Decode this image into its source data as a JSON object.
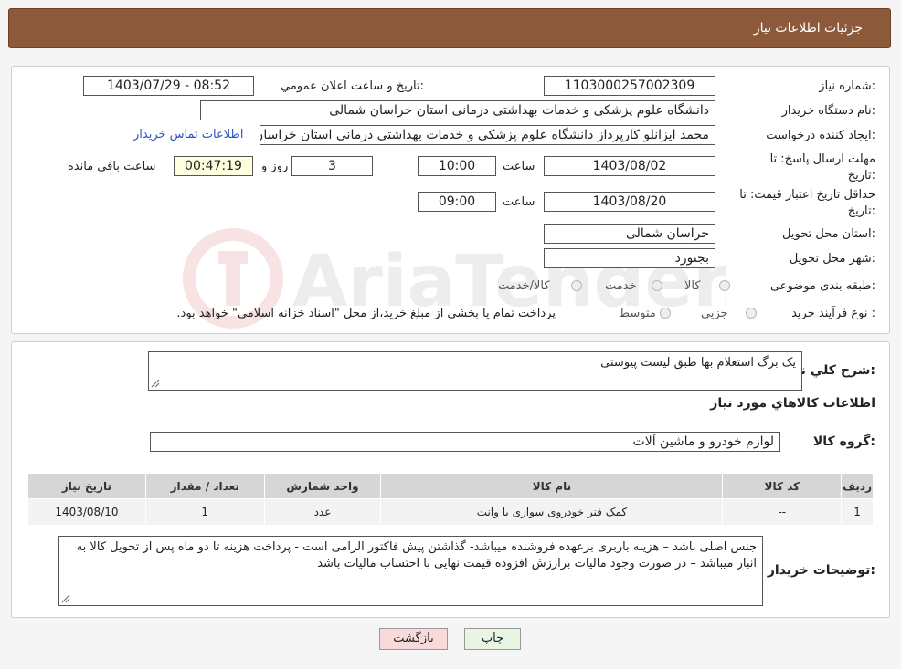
{
  "header": {
    "title": "جزئیات اطلاعات نیاز"
  },
  "form": {
    "need_number_label": "شماره نیاز:",
    "need_number": "1103000257002309",
    "announce_label": "تاریخ و ساعت اعلان عمومي:",
    "announce_value": "1403/07/29 - 08:52",
    "buyer_org_label": "نام دستگاه خريدار:",
    "buyer_org": "دانشگاه علوم پزشکی و خدمات بهداشتی درمانی استان خراسان شمالی",
    "requester_label": "ايجاد کننده درخواست:",
    "requester": "محمد ایزانلو کارپرداز دانشگاه علوم پزشکی و خدمات بهداشتی درمانی استان خراسان شمالی",
    "contact_link": "اطلاعات تماس خريدار",
    "deadline_label_1": "مهلت ارسال پاسخ: تا",
    "deadline_label_2": "تاريخ:",
    "deadline_date": "1403/08/02",
    "time_label": "ساعت",
    "deadline_time": "10:00",
    "days_value": "3",
    "days_label": "روز و",
    "remaining_time": "00:47:19",
    "remaining_label": "ساعت باقي مانده",
    "validity_label_1": "حداقل تاريخ اعتبار قيمت: تا",
    "validity_label_2": "تاريخ:",
    "validity_date": "1403/08/20",
    "validity_time_label": "ساعت",
    "validity_time": "09:00",
    "province_label": "استان محل تحويل:",
    "province": "خراسان شمالی",
    "city_label": "شهر محل تحويل:",
    "city": "بجنورد",
    "category_label": "طبقه بندی موضوعی:",
    "category_options": [
      "کالا",
      "خدمت",
      "کالا/خدمت"
    ],
    "process_label": "نوع فرآيند خريد :",
    "process_options": [
      "جزيي",
      "متوسط"
    ],
    "process_note": "پرداخت تمام يا بخشی از مبلغ خريد،از محل \"اسناد خزانه اسلامی\" خواهد بود."
  },
  "details": {
    "summary_label": "شرح کلي نياز:",
    "summary": "یک برگ استعلام بها طبق لیست پیوستی",
    "goods_heading": "اطلاعات کالاهاي مورد نياز",
    "group_label": "گروه کالا:",
    "group_value": "لوازم خودرو و ماشین آلات",
    "table": {
      "headers": [
        "رديف",
        "کد کالا",
        "نام کالا",
        "واحد شمارش",
        "تعداد / مقدار",
        "تاريخ نياز"
      ],
      "rows": [
        [
          "1",
          "--",
          "کمک فنر خودروی سواری یا وانت",
          "عدد",
          "1",
          "1403/08/10"
        ]
      ]
    },
    "buyer_notes_label": "توضيحات خريدار:",
    "buyer_notes": "جنس اصلی باشد – هزینه باربری برعهده فروشنده میباشد- گذاشتن پیش فاکتور الزامی است - پرداخت هزینه تا دو ماه پس از تحویل کالا به انبار میباشد – در صورت وجود مالیات برارزش افزوده قیمت نهایی با احتساب مالیات باشد"
  },
  "buttons": {
    "print": "چاپ",
    "back": "بازگشت"
  },
  "watermark": {
    "text": "AriaTender.net"
  },
  "colors": {
    "header_bg": "#8c5a3a",
    "link": "#2b52c8",
    "back_button": "#f8dada",
    "print_button": "#e8f5e0"
  }
}
